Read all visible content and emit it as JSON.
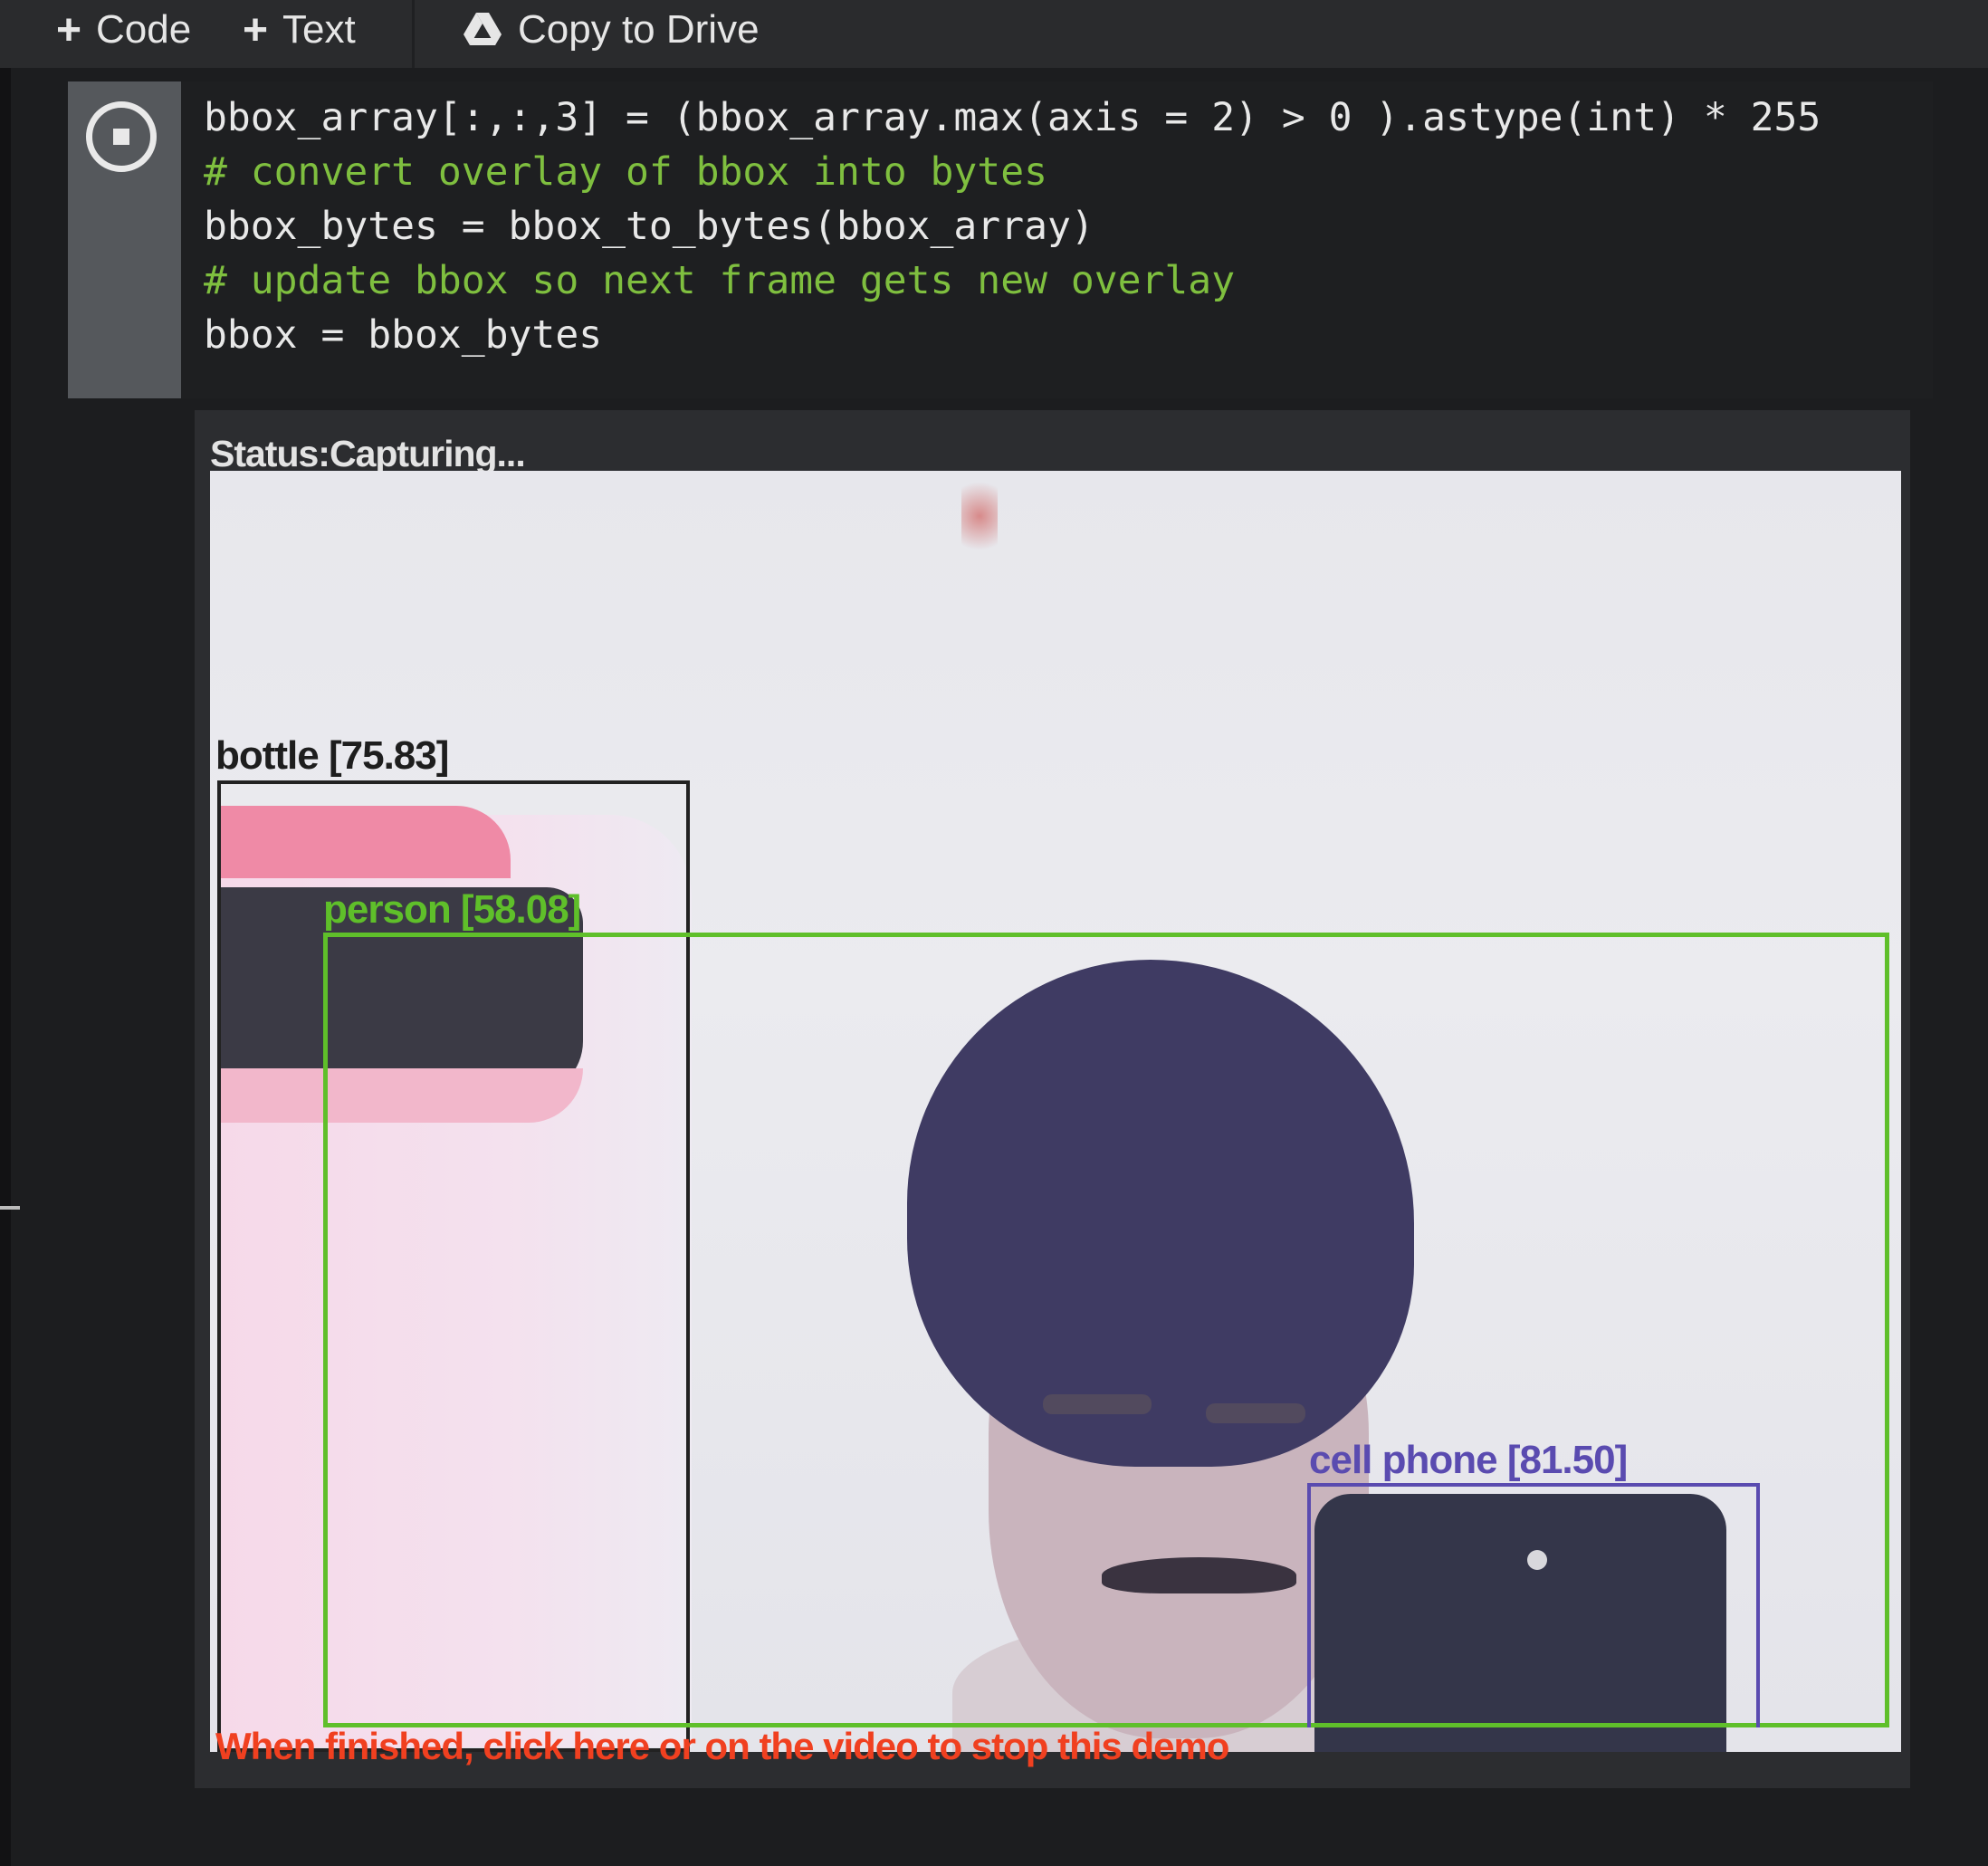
{
  "toolbar": {
    "code_label": "Code",
    "text_label": "Text",
    "drive_label": "Copy to Drive"
  },
  "code_lines": [
    "bbox_array[:,:,3] = (bbox_array.max(axis = 2) > 0 ).astype(int) * 255",
    "# convert overlay of bbox into bytes",
    "bbox_bytes = bbox_to_bytes(bbox_array)",
    "# update bbox so next frame gets new overlay",
    "bbox = bbox_bytes"
  ],
  "output": {
    "status": "Status:Capturing...",
    "finish_text": "When finished, click here or on the video to stop this demo"
  },
  "detections": [
    {
      "label": "bottle [75.83]",
      "color": "#222222"
    },
    {
      "label": "person [58.08]",
      "color": "#5fbf2a"
    },
    {
      "label": "cell phone [81.50]",
      "color": "#5a4bb0"
    }
  ],
  "colors": {
    "finish_text": "#f04020",
    "person_box": "#5fbf2a",
    "phone_box": "#5a4bb0",
    "bottle_box": "#222222"
  },
  "icons": {
    "code_plus": "plus-icon",
    "text_plus": "plus-icon",
    "drive": "google-drive-icon",
    "stop": "stop-icon"
  }
}
